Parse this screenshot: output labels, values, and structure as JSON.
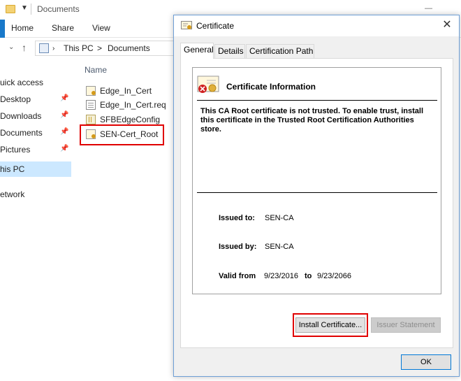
{
  "explorer": {
    "window_title": "Documents",
    "ribbon_tabs": [
      "Home",
      "Share",
      "View"
    ],
    "breadcrumb": [
      "This PC",
      "Documents"
    ],
    "breadcrumb_separator": ">",
    "nav_items": [
      {
        "label": "uick access",
        "pinned": false
      },
      {
        "label": "Desktop",
        "pinned": true
      },
      {
        "label": "Downloads",
        "pinned": true
      },
      {
        "label": "Documents",
        "pinned": true
      },
      {
        "label": "Pictures",
        "pinned": true
      },
      {
        "label": "his PC",
        "pinned": false,
        "selected": true
      },
      {
        "label": "etwork",
        "pinned": false
      }
    ],
    "column_header": "Name",
    "files": [
      {
        "name": "Edge_In_Cert",
        "icon": "certificate-file-icon"
      },
      {
        "name": "Edge_In_Cert.req",
        "icon": "text-file-icon"
      },
      {
        "name": "SFBEdgeConfig",
        "icon": "config-file-icon"
      },
      {
        "name": "SEN-Cert_Root",
        "icon": "certificate-file-icon",
        "highlighted": true
      }
    ]
  },
  "dialog": {
    "title": "Certificate",
    "tabs": [
      "General",
      "Details",
      "Certification Path"
    ],
    "active_tab": "General",
    "info_title": "Certificate Information",
    "warning": "This CA Root certificate is not trusted. To enable trust, install this certificate in the Trusted Root Certification Authorities store.",
    "issued_to_label": "Issued to:",
    "issued_to_value": "SEN-CA",
    "issued_by_label": "Issued by:",
    "issued_by_value": "SEN-CA",
    "valid_from_label": "Valid from",
    "valid_from_value": "9/23/2016",
    "valid_to_label": "to",
    "valid_to_value": "9/23/2066",
    "install_button": "Install Certificate...",
    "issuer_button": "Issuer Statement",
    "ok_button": "OK"
  },
  "colors": {
    "highlight_red": "#e00000",
    "selection_blue": "#cce8ff",
    "accent": "#0078d7"
  }
}
